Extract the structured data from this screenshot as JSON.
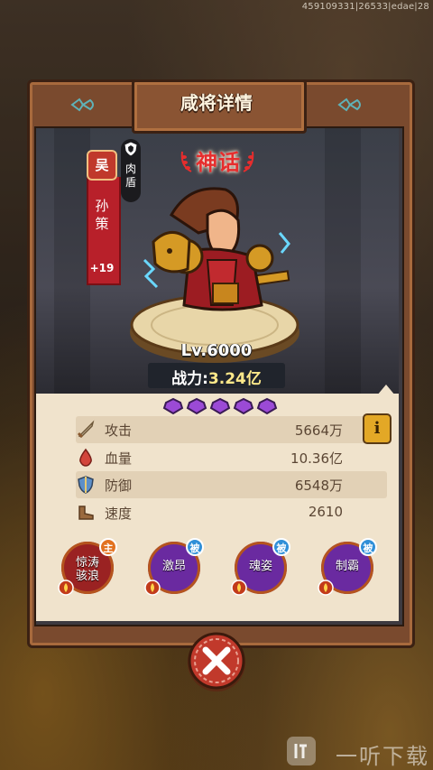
{
  "debug_text": "459109331|26533|edae|28",
  "title": "咸将详情",
  "hero": {
    "faction": "吴",
    "name": "孙策",
    "plus": "+19",
    "role": "肉盾",
    "rarity": "神话",
    "level": "Lv.6000",
    "power_label": "战力:",
    "power_value": "3.24亿",
    "star_count": 5
  },
  "stats": [
    {
      "icon": "sword-icon",
      "label": "攻击",
      "value": "5664万"
    },
    {
      "icon": "blood-drop-icon",
      "label": "血量",
      "value": "10.36亿"
    },
    {
      "icon": "shield-icon",
      "label": "防御",
      "value": "6548万"
    },
    {
      "icon": "boot-icon",
      "label": "速度",
      "value": "2610"
    }
  ],
  "info_label": "i",
  "skills": [
    {
      "name": "惊涛骇浪",
      "tag": "主",
      "tag_color": "#e2721f",
      "bg": "#9a2222"
    },
    {
      "name": "激昂",
      "tag": "被",
      "tag_color": "#2f8fd8",
      "bg": "#6a2aa0"
    },
    {
      "name": "魂姿",
      "tag": "被",
      "tag_color": "#2f8fd8",
      "bg": "#6a2aa0"
    },
    {
      "name": "制霸",
      "tag": "被",
      "tag_color": "#2f8fd8",
      "bg": "#6a2aa0"
    }
  ],
  "watermark": "一听下载",
  "colors": {
    "rarity": "#e62d2d",
    "panel": "#f0e3cc",
    "frame": "#7a4a2e"
  }
}
